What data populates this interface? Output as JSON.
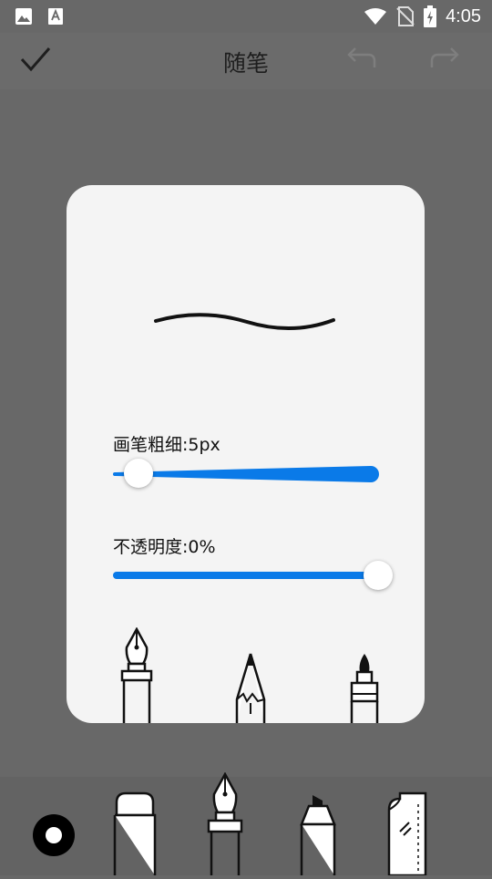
{
  "status_bar": {
    "time": "4:05",
    "left_icons": [
      "image-icon",
      "keyboard-a-icon"
    ],
    "right_icons": [
      "wifi-icon",
      "no-sim-icon",
      "battery-charging-icon"
    ]
  },
  "app_bar": {
    "title": "随笔",
    "confirm_icon": "check-icon",
    "undo_icon": "undo-icon",
    "redo_icon": "redo-icon"
  },
  "dialog": {
    "thickness_label": "画笔粗细:5px",
    "thickness_value_px": 5,
    "opacity_label": "不透明度:0%",
    "opacity_value_percent": 0,
    "accent_color": "#0a7ae8",
    "pen_options": [
      "fountain-pen-icon",
      "pencil-icon",
      "brush-pen-icon"
    ]
  },
  "toolbar": {
    "tools": [
      "brush-settings-icon",
      "eraser-icon",
      "fountain-pen-icon",
      "marker-icon",
      "ruler-icon"
    ]
  }
}
